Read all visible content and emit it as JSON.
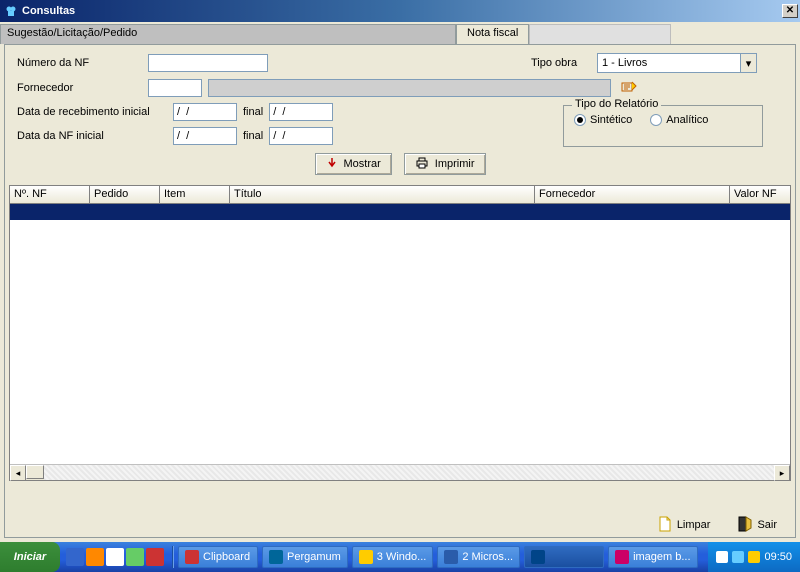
{
  "window": {
    "title": "Consultas"
  },
  "tabs": {
    "first": "Sugestão/Licitação/Pedido",
    "active": "Nota fiscal"
  },
  "form": {
    "numero_nf_label": "Número da NF",
    "numero_nf_value": "",
    "tipo_obra_label": "Tipo obra",
    "tipo_obra_value": "1 - Livros",
    "fornecedor_label": "Fornecedor",
    "fornecedor_code": "",
    "fornecedor_desc": "",
    "data_receb_label": "Data de recebimento inicial",
    "data_nf_label": "Data da NF inicial",
    "final_label": "final",
    "date_placeholder": "/  /",
    "relatorio": {
      "legend": "Tipo do Relatório",
      "sintetico": "Sintético",
      "analitico": "Analítico",
      "selected": "sintetico"
    },
    "buttons": {
      "mostrar": "Mostrar",
      "imprimir": "Imprimir"
    }
  },
  "grid": {
    "columns": [
      "Nº. NF",
      "Pedido",
      "Item",
      "Título",
      "Fornecedor",
      "Valor NF"
    ]
  },
  "footer": {
    "limpar": "Limpar",
    "sair": "Sair"
  },
  "taskbar": {
    "start": "Iniciar",
    "tasks": [
      "Clipboard",
      "Pergamum",
      "3 Windo...",
      "2 Micros...",
      "",
      "imagem b..."
    ],
    "clock": "09:50"
  }
}
